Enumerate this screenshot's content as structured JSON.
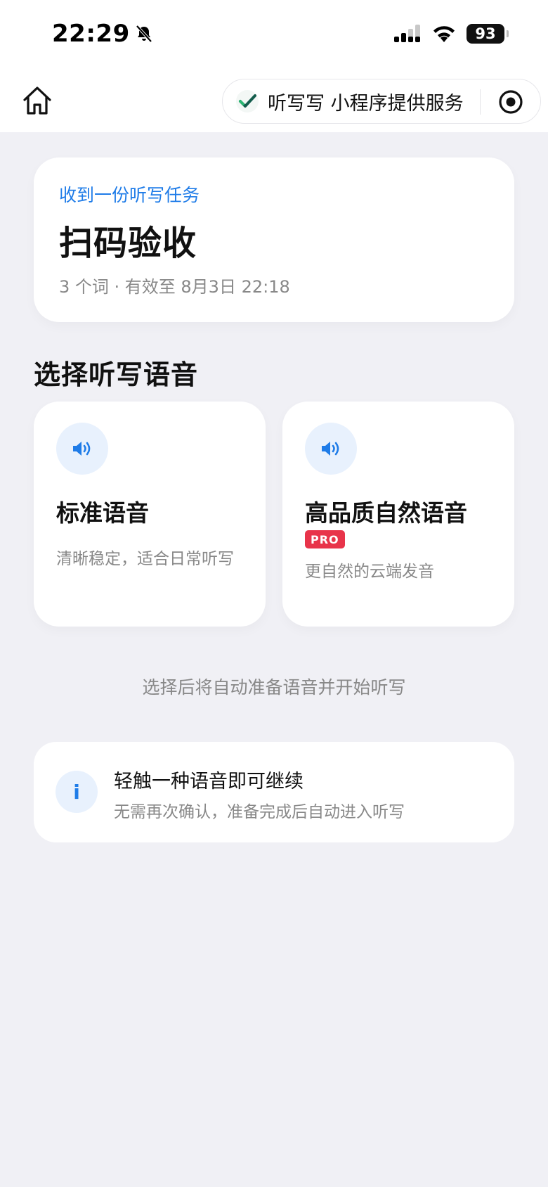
{
  "status_bar": {
    "time": "22:29",
    "battery": "93",
    "icons": [
      "bell-off-icon",
      "cellular-signal-icon",
      "wifi-icon",
      "battery-icon"
    ]
  },
  "nav": {
    "home_icon": "home-icon",
    "capsule_text": "听写写 小程序提供服务",
    "capsule_icons": [
      "checkmark-logo-icon",
      "record-dot-icon"
    ]
  },
  "task": {
    "kicker": "收到一份听写任务",
    "title": "扫码验收",
    "meta": "3 个词 · 有效至 8月3日 22:18"
  },
  "voice_section": {
    "title": "选择听写语音",
    "options": [
      {
        "name": "标准语音",
        "desc": "清晰稳定，适合日常听写",
        "icon": "speaker-icon"
      },
      {
        "name": "高品质自然语音",
        "badge": "PRO",
        "desc": "更自然的云端发音",
        "icon": "speaker-icon"
      }
    ]
  },
  "hint": "选择后将自动准备语音并开始听写",
  "info": {
    "icon_glyph": "i",
    "title": "轻触一种语音即可继续",
    "subtitle": "无需再次确认，准备完成后自动进入听写"
  },
  "colors": {
    "accent": "#1f7ce8",
    "pro_badge": "#e8344a",
    "background": "#f0f0f5",
    "icon_bg": "#e8f1fd",
    "logo_green": "#2bb673",
    "logo_dark": "#135c4c"
  }
}
